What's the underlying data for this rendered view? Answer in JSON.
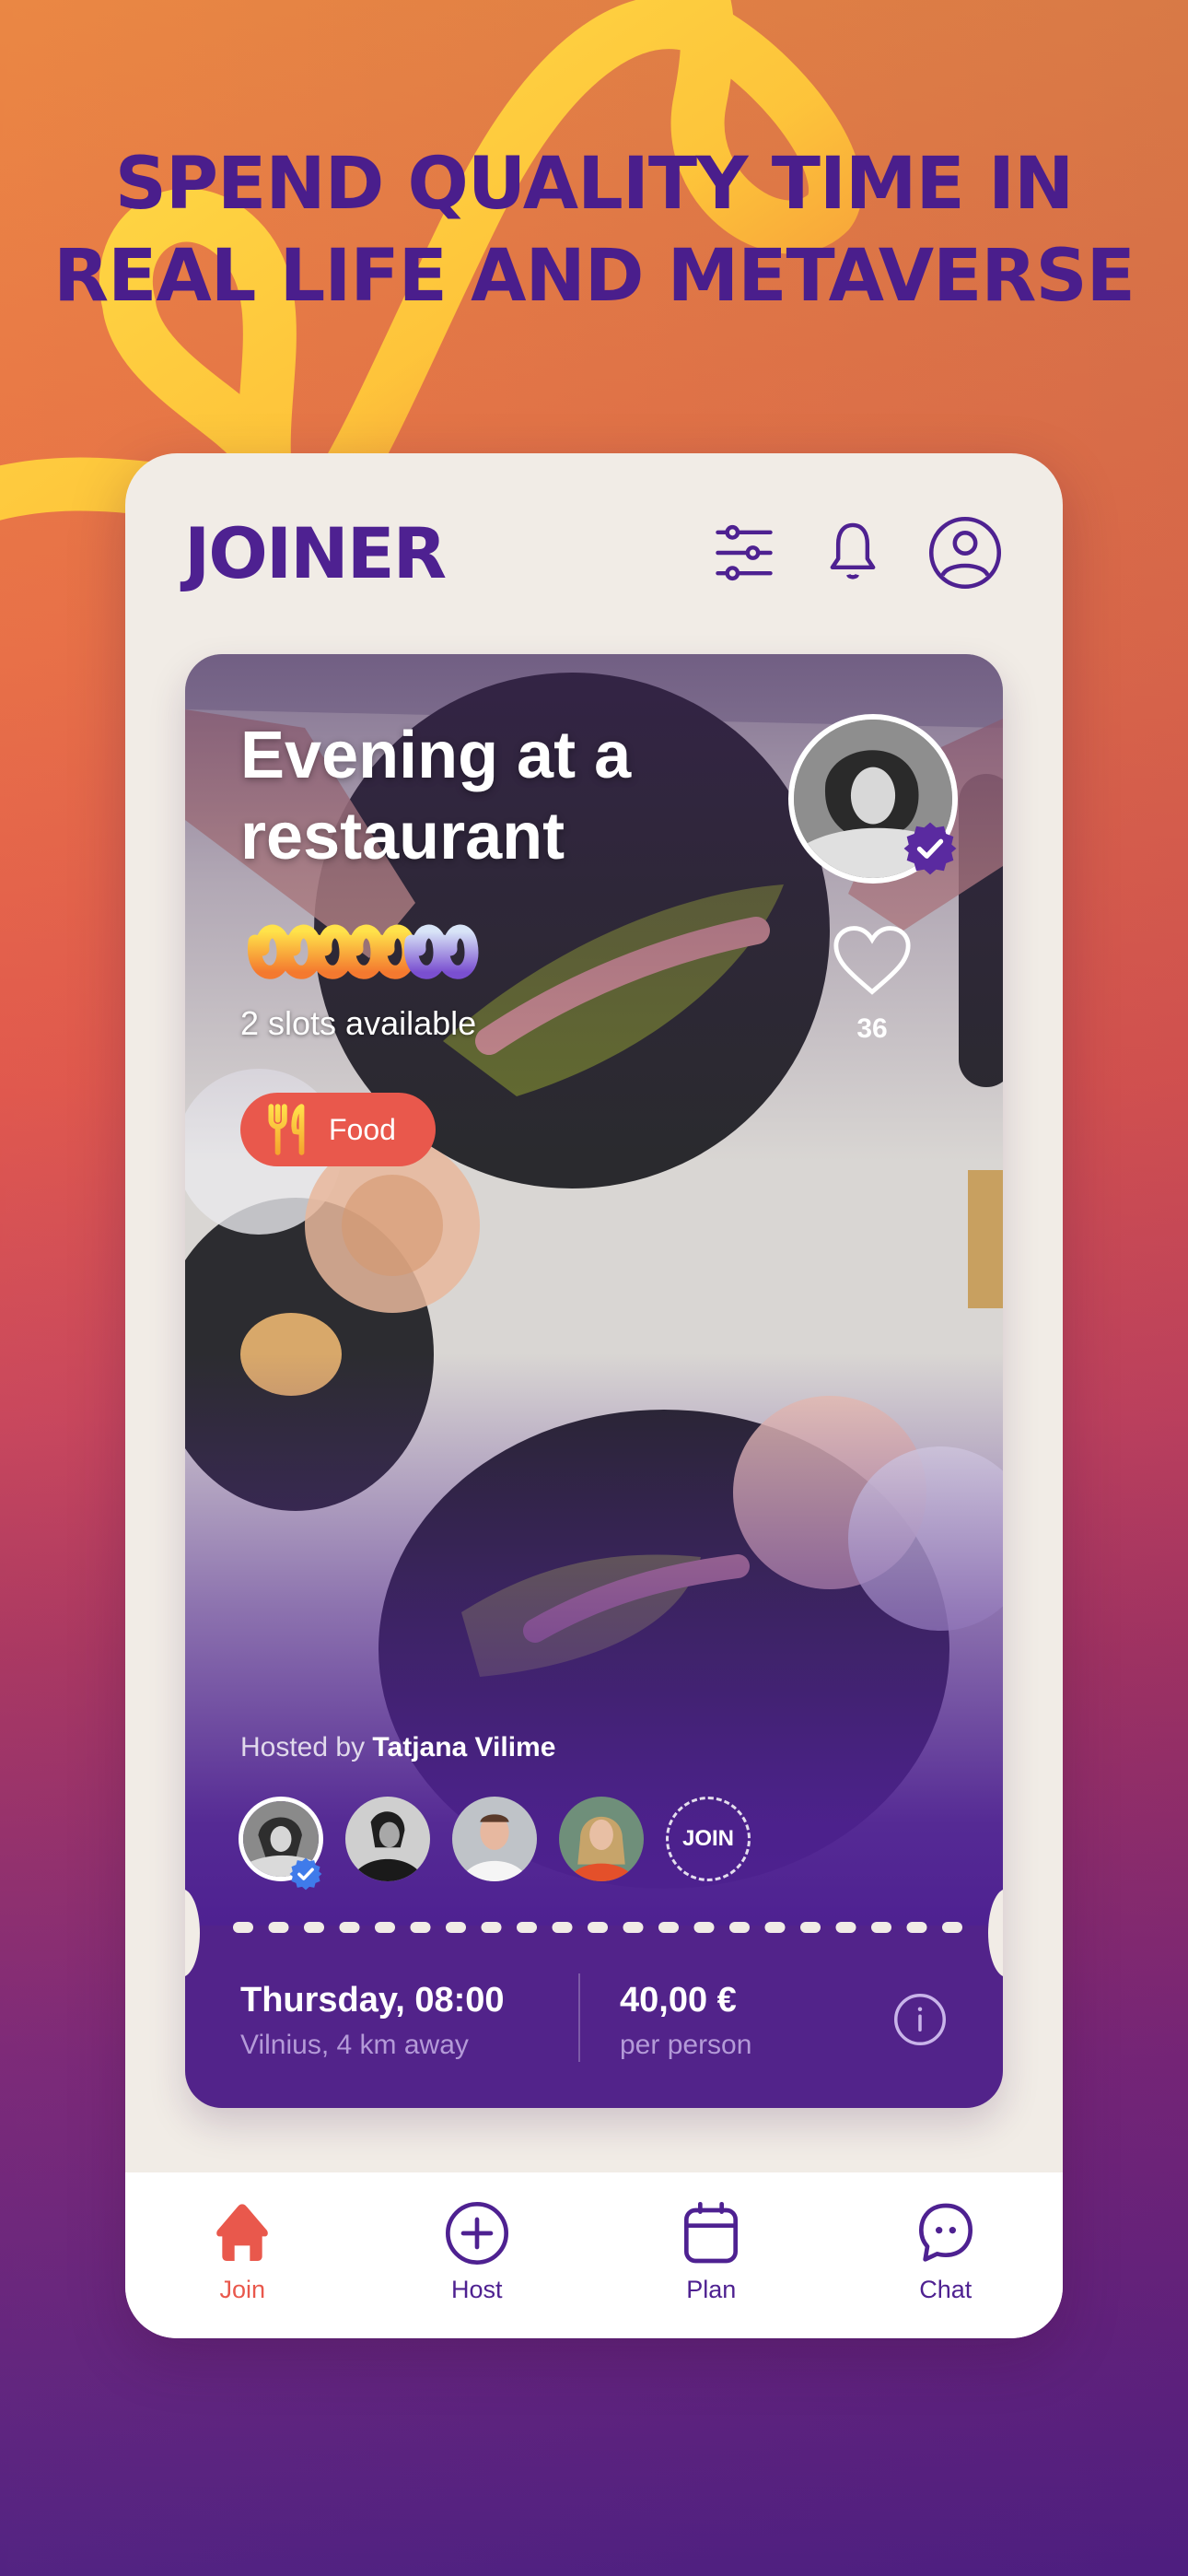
{
  "headline": {
    "line1": "SPEND QUALITY TIME IN",
    "line2": "REAL LIFE AND METAVERSE"
  },
  "colors": {
    "brand_purple": "#4E2191",
    "accent_coral": "#E9584C",
    "card_bg": "#F1ECE6"
  },
  "app": {
    "logo": "JOINER",
    "header_icons": [
      "filter-sliders-icon",
      "bell-icon",
      "profile-icon"
    ]
  },
  "event": {
    "title": "Evening at a restaurant",
    "slots": {
      "total": 7,
      "taken": 5,
      "available": 2
    },
    "slots_text": "2 slots available",
    "likes": "36",
    "category": {
      "label": "Food",
      "icon": "fork-knife-icon"
    },
    "hosted_by_prefix": "Hosted by",
    "host_name": "Tatjana Vilime",
    "host_verified": true,
    "participants": [
      {
        "name": "Tatjana Vilime",
        "role": "host",
        "verified": true
      },
      {
        "name": "participant-2"
      },
      {
        "name": "participant-3"
      },
      {
        "name": "participant-4"
      }
    ],
    "join_label": "JOIN",
    "datetime": "Thursday, 08:00",
    "location": "Vilnius, 4 km away",
    "price": "40,00 €",
    "price_unit": "per person"
  },
  "tabs": [
    {
      "label": "Join",
      "icon": "home-icon",
      "active": true
    },
    {
      "label": "Host",
      "icon": "plus-circle-icon",
      "active": false
    },
    {
      "label": "Plan",
      "icon": "calendar-icon",
      "active": false
    },
    {
      "label": "Chat",
      "icon": "chat-bubble-icon",
      "active": false
    }
  ]
}
